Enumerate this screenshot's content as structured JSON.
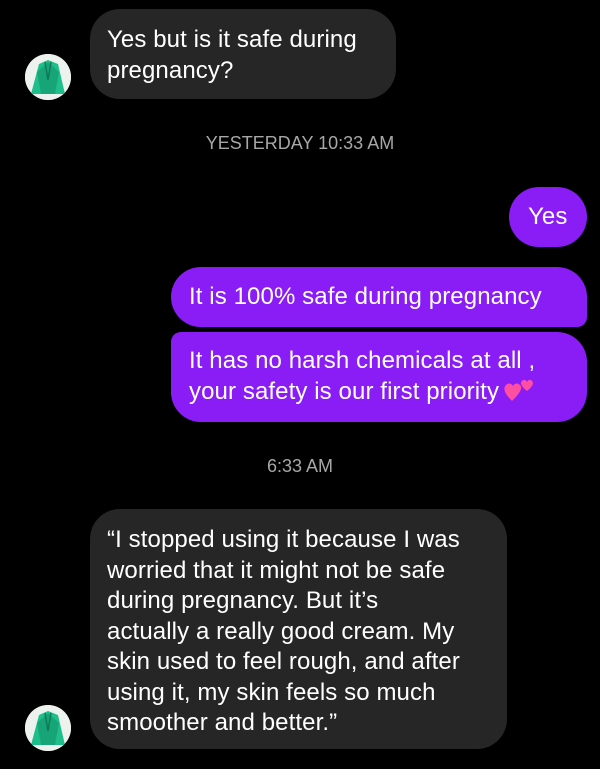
{
  "thread": {
    "messages": [
      {
        "from": "them",
        "lines": [
          "Yes but is it safe during",
          "pregnancy?"
        ]
      },
      {
        "timestamp": "YESTERDAY 10:33 AM"
      },
      {
        "from": "me",
        "lines": [
          "Yes"
        ]
      },
      {
        "from": "me",
        "lines": [
          "It is 100% safe during pregnancy"
        ]
      },
      {
        "from": "me",
        "lines": [
          "It has no harsh chemicals at all ,",
          "your safety is our first priority"
        ],
        "emoji": "two-hearts-icon"
      },
      {
        "timestamp": "6:33 AM"
      },
      {
        "from": "them",
        "lines": [
          "“I stopped using it because I was",
          "worried that it might not be safe",
          "during pregnancy. But it’s",
          "actually a really good cream. My",
          "skin used to feel rough, and after",
          "using it, my skin feels so much",
          "smoother and better.”"
        ]
      }
    ]
  },
  "colors": {
    "background": "#000000",
    "incoming_bubble": "#262626",
    "outgoing_bubble": "#8a1cf5",
    "timestamp_text": "#a7a7a7",
    "avatar_accent": "#1fbf8c"
  }
}
